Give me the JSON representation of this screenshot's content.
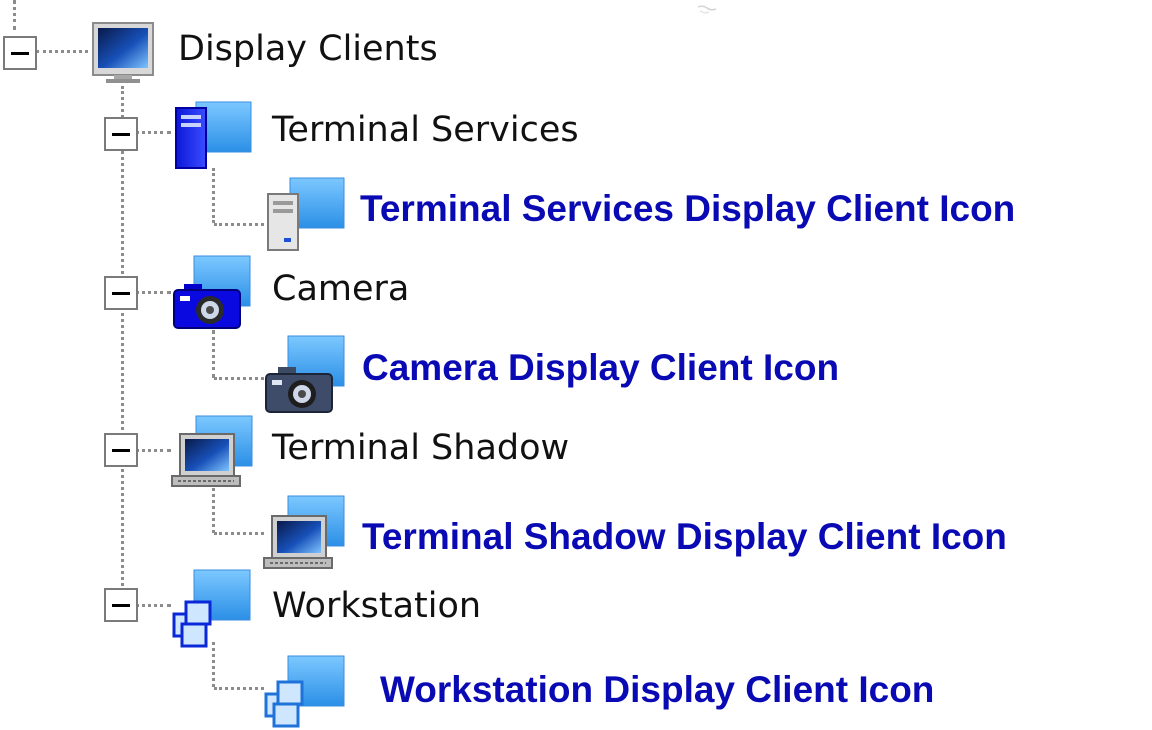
{
  "tree": {
    "root": {
      "label": "Display Clients",
      "icon": "monitor-icon",
      "expanded": true
    },
    "children": [
      {
        "label": "Terminal Services",
        "icon": "terminal-services-icon",
        "expanded": true,
        "child_label": "Terminal Services Display Client Icon",
        "child_icon": "terminal-services-display-client-icon"
      },
      {
        "label": "Camera",
        "icon": "camera-icon",
        "expanded": true,
        "child_label": "Camera Display Client Icon",
        "child_icon": "camera-display-client-icon"
      },
      {
        "label": "Terminal Shadow",
        "icon": "laptop-icon",
        "expanded": true,
        "child_label": "Terminal Shadow Display Client Icon",
        "child_icon": "terminal-shadow-display-client-icon"
      },
      {
        "label": "Workstation",
        "icon": "workstation-icon",
        "expanded": true,
        "child_label": "Workstation Display Client Icon",
        "child_icon": "workstation-display-client-icon"
      }
    ]
  },
  "colors": {
    "description_text": "#0a0ab4",
    "label_text": "#111111",
    "connector": "#8c8c8c",
    "monitor_screen": "#1a6ed8"
  }
}
